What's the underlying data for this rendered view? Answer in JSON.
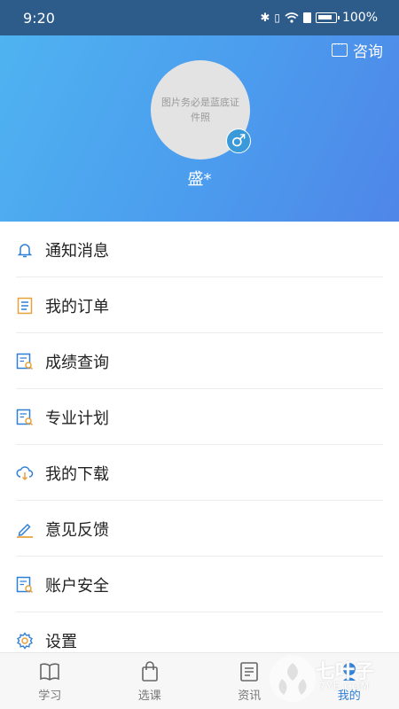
{
  "status_bar": {
    "time": "9:20",
    "battery": "100%"
  },
  "header": {
    "consult_label": "咨询",
    "avatar_text": "图片务必是蓝底证件照",
    "gender_symbol": "♂",
    "username": "盛*"
  },
  "menu": [
    {
      "label": "通知消息",
      "icon": "bell-icon"
    },
    {
      "label": "我的订单",
      "icon": "order-icon"
    },
    {
      "label": "成绩查询",
      "icon": "grade-search-icon"
    },
    {
      "label": "专业计划",
      "icon": "plan-icon"
    },
    {
      "label": "我的下载",
      "icon": "cloud-download-icon"
    },
    {
      "label": "意见反馈",
      "icon": "pencil-icon"
    },
    {
      "label": "账户安全",
      "icon": "account-security-icon"
    },
    {
      "label": "设置",
      "icon": "settings-icon"
    }
  ],
  "tabbar": [
    {
      "label": "学习",
      "icon": "book-icon",
      "active": false
    },
    {
      "label": "选课",
      "icon": "bag-icon",
      "active": false
    },
    {
      "label": "资讯",
      "icon": "news-icon",
      "active": false
    },
    {
      "label": "我的",
      "icon": "user-icon",
      "active": true
    }
  ],
  "watermark": {
    "brand": "七叶子",
    "site": "7YE.COM"
  },
  "colors": {
    "accent": "#2f7fd6",
    "header_start": "#4fb3f0",
    "header_end": "#4f86e8",
    "status_bar": "#2e5c8a"
  }
}
